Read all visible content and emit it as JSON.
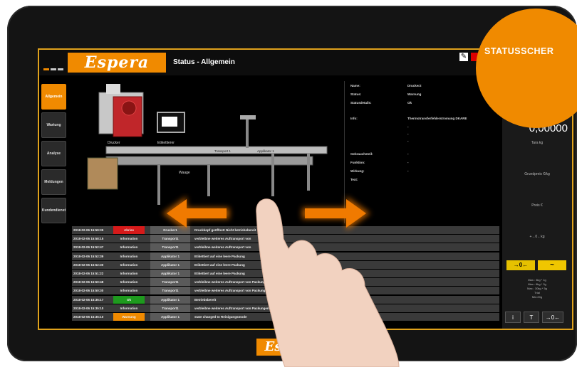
{
  "app": {
    "logo_text": "Espera",
    "title": "Status - Allgemein",
    "bottom_logo_text": "Espera"
  },
  "badge": {
    "text": "STATUSSCHER"
  },
  "sidebar": {
    "items": [
      {
        "label": "Allgemein",
        "active": true
      },
      {
        "label": "Wartung",
        "active": false
      },
      {
        "label": "Analyse",
        "active": false
      },
      {
        "label": "Meldungen",
        "active": false
      },
      {
        "label": "Kundendienst",
        "active": false
      }
    ]
  },
  "info": {
    "name_label": "Name:",
    "name_value": "Drucker2",
    "status_label": "Status:",
    "status_value": "Warnung",
    "detail_label": "Statusdetails:",
    "detail_value": "Ok",
    "info_label": "Info:",
    "info_value": "Thermotransferfehlerstromung DKARE",
    "dash1": "-",
    "dash2": "-",
    "dash3": "-",
    "device_label": "Gebrauchsteil:",
    "device_value": "-",
    "function_label": "Funktion:",
    "function_value": "-",
    "effect_label": "Wirkung:",
    "effect_value": "-",
    "text_label": "Text:"
  },
  "right_panel": {
    "value": "0,00000",
    "tara": "Tara kg",
    "grundpreis": "Grundpreis €/kg",
    "preis": "Preis €",
    "weight_unit": "+→0←kg",
    "zero_button": "→0←",
    "tilde_button": "~",
    "scale_lines": [
      "Max.: 3kg * 1g",
      "Max.: 6kg * 2g",
      "Max.: 30kg * 5g",
      "Trial",
      "Min:20g"
    ],
    "info_button": "i",
    "tare_button": "T",
    "zero_button2": "→0←"
  },
  "machine_labels": [
    "Drucker",
    "Etikettierer",
    "Transport 1",
    "Applikator 1",
    "Waage"
  ],
  "log": {
    "rows": [
      {
        "time": "2018-02-06 15:59:35",
        "type": "Abriss",
        "type_color": "#d61a1a",
        "source": "Drucker1",
        "message": "Druckkopf geöffnet! Nicht betriebsbereit"
      },
      {
        "time": "2018-02-06 15:58:15",
        "type": "Information",
        "type_color": "#3a3a3a",
        "source": "Transport1",
        "message": "verbleibne weiteres Auftransport von"
      },
      {
        "time": "2018-02-06 15:52:47",
        "type": "Information",
        "type_color": "#3a3a3a",
        "source": "Transport1",
        "message": "verbleibne weiteres Auftransport von"
      },
      {
        "time": "2018-02-06 15:52:39",
        "type": "Information",
        "type_color": "#3a3a3a",
        "source": "Applikator 1",
        "message": "Etikettiert auf eine leere Packung"
      },
      {
        "time": "2018-02-06 15:52:30",
        "type": "Information",
        "type_color": "#3a3a3a",
        "source": "Applikator 1",
        "message": "Etikettiert auf eine leere Packung"
      },
      {
        "time": "2018-02-06 15:51:22",
        "type": "Information",
        "type_color": "#3a3a3a",
        "source": "Applikator 1",
        "message": "Etikettiert auf eine leere Packung"
      },
      {
        "time": "2018-02-06 15:50:48",
        "type": "Information",
        "type_color": "#3a3a3a",
        "source": "Transport1",
        "message": "verbleibne weiteres Auftransport von Packungen"
      },
      {
        "time": "2018-02-06 15:50:30",
        "type": "Information",
        "type_color": "#3a3a3a",
        "source": "Transport1",
        "message": "verbleibne weiteres Auftransport von Packungen"
      },
      {
        "time": "2018-02-06 15:36:17",
        "type": "Ok",
        "type_color": "#1e9a1e",
        "source": "Applikator 1",
        "message": "Betriebsbereit"
      },
      {
        "time": "2018-02-06 15:35:10",
        "type": "Information",
        "type_color": "#3a3a3a",
        "source": "Transport1",
        "message": "verbleibne weiteres Auftransport von Packungen"
      },
      {
        "time": "2018-02-06 15:35:10",
        "type": "Warnung",
        "type_color": "#f08a00",
        "source": "Applikator 1",
        "message": "state changed to Reinigungsmode"
      }
    ]
  }
}
